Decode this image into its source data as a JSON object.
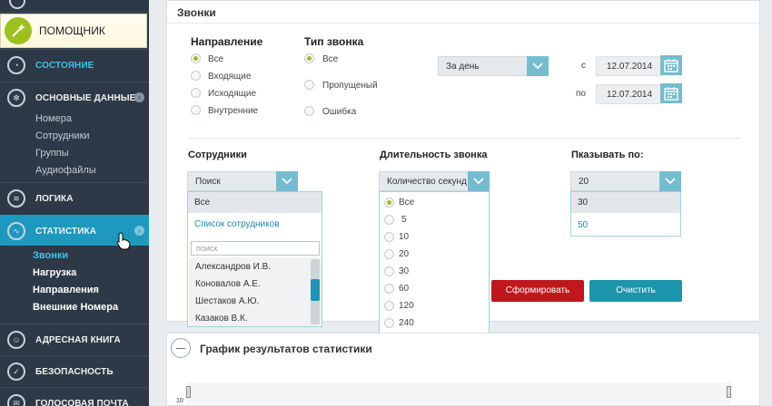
{
  "sidebar": {
    "helper_label": "ПОМОЩНИК",
    "items": [
      {
        "label": "СОСТОЯНИЕ"
      },
      {
        "label": "ОСНОВНЫЕ ДАННЫЕ"
      },
      {
        "label": "ЛОГИКА"
      },
      {
        "label": "СТАТИСТИКА"
      },
      {
        "label": "АДРЕСНАЯ КНИГА"
      },
      {
        "label": "БЕЗОПАСНОСТЬ"
      },
      {
        "label": "ГОЛОСОВАЯ ПОЧТА"
      }
    ],
    "basic_sub": [
      "Номера",
      "Сотрудники",
      "Группы",
      "Аудиофайлы"
    ],
    "stats_sub": [
      "Звонки",
      "Нагрузка",
      "Направления",
      "Внешние Номера"
    ],
    "colors": {
      "background": "#2d3946",
      "active": "#1d99bf",
      "accent": "#3ec2e8",
      "helper_icon": "#9cc11f"
    }
  },
  "panel": {
    "title": "Звонки",
    "direction": {
      "title": "Направление",
      "options": [
        "Все",
        "Входящие",
        "Исходящие",
        "Внутренние"
      ],
      "selected": "Все"
    },
    "call_type": {
      "title": "Тип звонка",
      "options": [
        "Все",
        "Пропущеный",
        "Ошибка"
      ],
      "selected": "Все"
    },
    "period": {
      "value": "За день"
    },
    "date_from": {
      "label": "с",
      "value": "12.07.2014"
    },
    "date_to": {
      "label": "по",
      "value": "12.07.2014"
    },
    "employees": {
      "title": "Сотрудники",
      "select_value": "Поиск",
      "dropdown": {
        "all": "Все",
        "list_link": "Список сотрудников",
        "search_placeholder": "поиск",
        "names": [
          "Александров  И.В.",
          "Коновалов А.Е.",
          "Шестаков А.Ю.",
          "Казаков В.К."
        ]
      }
    },
    "duration": {
      "title": "Длительность звонка",
      "select_value": "Количество секунд",
      "options": [
        "Все",
        "5",
        "10",
        "20",
        "30",
        "60",
        "120",
        "240"
      ],
      "selected": "Все"
    },
    "show_by": {
      "title": "Пказывать по:",
      "select_value": "20",
      "options": [
        "30",
        "50"
      ]
    },
    "buttons": {
      "generate": "Сформировать",
      "clear": "Очистить"
    },
    "colors": {
      "generate": "#c0171c",
      "clear": "#1d95aa",
      "select_button": "#74bdd0",
      "radio_on": "#9cc11f"
    }
  },
  "chart_section": {
    "title": "График результатов статистики",
    "y_tick": "10"
  }
}
